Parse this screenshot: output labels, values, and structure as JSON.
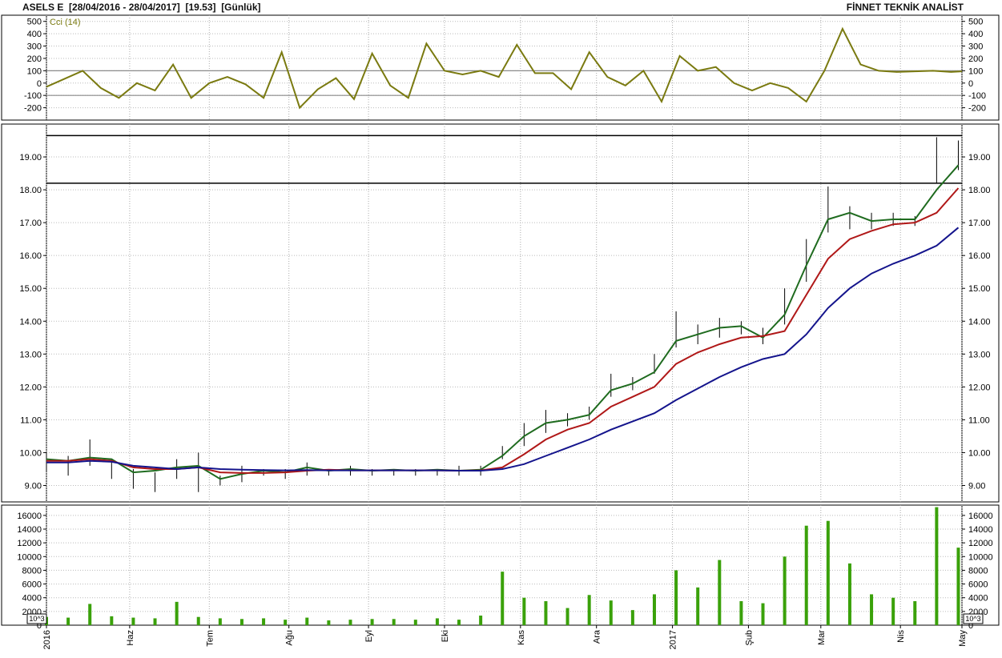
{
  "header": {
    "symbol": "ASELS E",
    "date_range": "[28/04/2016 - 28/04/2017]",
    "last_price": "[19.53]",
    "period": "[Günlük]",
    "provider": "FİNNET TEKNİK ANALİST"
  },
  "colors": {
    "price_bars": "#000000",
    "ma_short": "#1f6b1f",
    "ma_mid": "#b01818",
    "ma_long": "#14148c",
    "cci": "#7a7a10",
    "volume": "#3aa10a",
    "frame": "#000000"
  },
  "chart_data": [
    {
      "type": "line",
      "name": "cci_panel",
      "series_label": "Cci (14)",
      "ylim": [
        -300,
        550
      ],
      "yticks": [
        500,
        400,
        300,
        200,
        100,
        0,
        -100,
        -200
      ],
      "reference_lines": [
        100,
        -100
      ],
      "x": [
        0,
        10,
        15,
        20,
        25,
        30,
        35,
        40,
        45,
        50,
        55,
        60,
        65,
        70,
        75,
        80,
        85,
        90,
        95,
        100,
        105,
        110,
        115,
        120,
        125,
        130,
        135,
        140,
        145,
        150,
        155,
        160,
        165,
        170,
        175,
        180,
        185,
        190,
        195,
        200,
        205,
        210,
        215,
        220,
        225,
        230,
        235,
        240,
        245,
        250,
        253
      ],
      "values": [
        -30,
        100,
        -40,
        -120,
        0,
        -60,
        150,
        -120,
        0,
        50,
        -10,
        -120,
        250,
        -200,
        -50,
        40,
        -130,
        240,
        -20,
        -120,
        320,
        100,
        70,
        100,
        50,
        310,
        80,
        80,
        -50,
        250,
        50,
        -20,
        100,
        -150,
        220,
        100,
        130,
        0,
        -60,
        0,
        -40,
        -150,
        100,
        440,
        150,
        100,
        90,
        95,
        100,
        90,
        95
      ]
    },
    {
      "type": "line",
      "name": "price_panel",
      "x_axis_labels": [
        "2016",
        "Haz",
        "Tem",
        "Ağu",
        "Eyl",
        "Eki",
        "Kas",
        "Ara",
        "2017",
        "Şub",
        "Mar",
        "Nis",
        "May"
      ],
      "ylim": [
        8.5,
        20.0
      ],
      "yticks": [
        9.0,
        10.0,
        11.0,
        12.0,
        13.0,
        14.0,
        15.0,
        16.0,
        17.0,
        18.0,
        19.0
      ],
      "horizontal_levels": [
        19.65,
        18.2
      ],
      "bars_note": "daily high-low bars",
      "x": [
        0,
        6,
        12,
        18,
        24,
        30,
        36,
        42,
        48,
        54,
        60,
        66,
        72,
        78,
        84,
        90,
        96,
        102,
        108,
        114,
        120,
        126,
        132,
        138,
        144,
        150,
        156,
        162,
        168,
        174,
        180,
        186,
        192,
        198,
        204,
        210,
        216,
        222,
        228,
        234,
        240,
        246,
        252
      ],
      "high": [
        10.0,
        9.9,
        10.4,
        9.8,
        9.5,
        9.4,
        9.8,
        10.0,
        9.3,
        9.6,
        9.5,
        9.5,
        9.7,
        9.5,
        9.6,
        9.5,
        9.5,
        9.5,
        9.5,
        9.6,
        9.6,
        10.2,
        10.9,
        11.3,
        11.2,
        11.4,
        12.4,
        12.3,
        13.0,
        14.3,
        13.9,
        14.1,
        14.0,
        13.8,
        15.0,
        16.5,
        18.1,
        17.5,
        17.3,
        17.3,
        17.2,
        19.6,
        19.5
      ],
      "low": [
        9.4,
        9.3,
        9.6,
        9.2,
        8.9,
        8.8,
        9.2,
        8.8,
        9.0,
        9.1,
        9.3,
        9.2,
        9.3,
        9.3,
        9.3,
        9.3,
        9.3,
        9.3,
        9.3,
        9.3,
        9.3,
        9.8,
        10.2,
        10.6,
        10.8,
        11.0,
        11.7,
        11.9,
        12.4,
        13.2,
        13.3,
        13.5,
        13.6,
        13.3,
        13.9,
        15.2,
        16.7,
        16.8,
        16.8,
        16.9,
        16.9,
        18.2,
        18.6
      ],
      "series": [
        {
          "name": "ma_short",
          "values": [
            9.8,
            9.75,
            9.85,
            9.8,
            9.4,
            9.45,
            9.55,
            9.6,
            9.2,
            9.35,
            9.45,
            9.4,
            9.55,
            9.45,
            9.5,
            9.45,
            9.48,
            9.45,
            9.48,
            9.45,
            9.48,
            9.9,
            10.5,
            10.9,
            11.0,
            11.15,
            11.9,
            12.1,
            12.45,
            13.4,
            13.6,
            13.8,
            13.85,
            13.5,
            14.2,
            15.7,
            17.1,
            17.3,
            17.05,
            17.1,
            17.1,
            18.0,
            18.75
          ]
        },
        {
          "name": "ma_mid",
          "values": [
            9.75,
            9.75,
            9.8,
            9.75,
            9.55,
            9.5,
            9.5,
            9.55,
            9.4,
            9.38,
            9.38,
            9.4,
            9.45,
            9.48,
            9.46,
            9.46,
            9.46,
            9.46,
            9.46,
            9.45,
            9.46,
            9.55,
            9.95,
            10.4,
            10.7,
            10.9,
            11.4,
            11.7,
            12.0,
            12.7,
            13.05,
            13.3,
            13.5,
            13.55,
            13.7,
            14.8,
            15.9,
            16.5,
            16.75,
            16.95,
            17.0,
            17.3,
            18.05
          ]
        },
        {
          "name": "ma_long",
          "values": [
            9.7,
            9.7,
            9.75,
            9.72,
            9.6,
            9.55,
            9.5,
            9.55,
            9.5,
            9.48,
            9.47,
            9.46,
            9.47,
            9.46,
            9.46,
            9.46,
            9.46,
            9.46,
            9.46,
            9.45,
            9.45,
            9.5,
            9.65,
            9.9,
            10.15,
            10.4,
            10.7,
            10.95,
            11.2,
            11.6,
            11.95,
            12.3,
            12.6,
            12.85,
            13.0,
            13.6,
            14.4,
            15.0,
            15.45,
            15.75,
            16.0,
            16.3,
            16.85
          ]
        }
      ]
    },
    {
      "type": "bar",
      "name": "volume_panel",
      "ylabel": "10^3",
      "ylim": [
        0,
        17500
      ],
      "yticks": [
        0,
        2000,
        4000,
        6000,
        8000,
        10000,
        12000,
        14000,
        16000
      ],
      "x": [
        0,
        6,
        12,
        18,
        24,
        30,
        36,
        42,
        48,
        54,
        60,
        66,
        72,
        78,
        84,
        90,
        96,
        102,
        108,
        114,
        120,
        126,
        132,
        138,
        144,
        150,
        156,
        162,
        168,
        174,
        180,
        186,
        192,
        198,
        204,
        210,
        216,
        222,
        228,
        234,
        240,
        246,
        252
      ],
      "values": [
        1200,
        1100,
        3100,
        1300,
        1100,
        1000,
        3400,
        1200,
        1000,
        900,
        1000,
        800,
        1100,
        700,
        800,
        900,
        900,
        800,
        1000,
        800,
        1400,
        7800,
        4000,
        3500,
        2500,
        4400,
        3600,
        2200,
        4500,
        8000,
        5500,
        9500,
        3500,
        3200,
        10000,
        14500,
        15200,
        9000,
        4500,
        4000,
        3500,
        17200,
        11300
      ]
    }
  ]
}
